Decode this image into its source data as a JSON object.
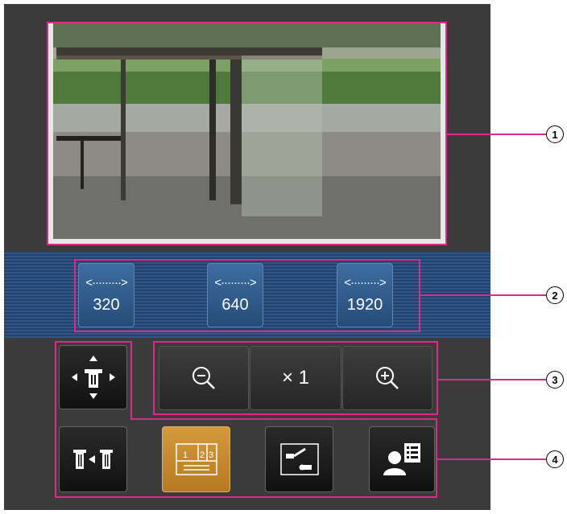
{
  "resolution_buttons": [
    {
      "arrow": "<·········>",
      "label": "320"
    },
    {
      "arrow": "<·········>",
      "label": "640"
    },
    {
      "arrow": "<·········>",
      "label": "1920"
    }
  ],
  "zoom": {
    "zoom_out_icon": "zoom-out-icon",
    "level_label": "× 1",
    "zoom_in_icon": "zoom-in-icon"
  },
  "controls": {
    "ptz_icon": "pan-tilt-control-icon",
    "camera_switch_icon": "camera-switch-icon",
    "multi_screen_icon": "multi-screen-icon",
    "preset_icon": "preset-icon",
    "user_icon": "user-list-icon"
  },
  "callouts": [
    "1",
    "2",
    "3",
    "4"
  ],
  "colors": {
    "highlight": "#e0288a",
    "active_button": "#c4882e",
    "band": "#2f5686"
  }
}
